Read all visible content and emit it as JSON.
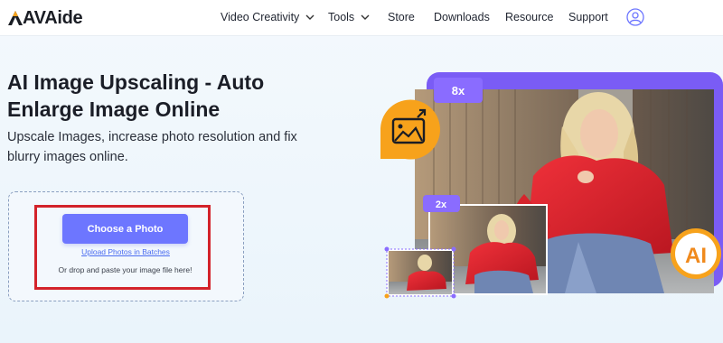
{
  "header": {
    "logo_text": "AVAide",
    "nav": [
      {
        "label": "Video Creativity",
        "has_dropdown": true
      },
      {
        "label": "Tools",
        "has_dropdown": true
      },
      {
        "label": "Store",
        "has_dropdown": false
      },
      {
        "label": "Downloads",
        "has_dropdown": false
      },
      {
        "label": "Resource",
        "has_dropdown": false
      },
      {
        "label": "Support",
        "has_dropdown": false
      }
    ],
    "user_icon": "user-circle-icon"
  },
  "hero": {
    "title": "AI Image Upscaling - Auto Enlarge Image Online",
    "subtitle": "Upscale Images, increase photo resolution and fix blurry images online."
  },
  "upload": {
    "choose_button": "Choose a Photo",
    "batch_link": "Upload Photos in Batches",
    "drop_text": "Or drop and paste your image file here!"
  },
  "illustration": {
    "badge_8x": "8x",
    "badge_2x": "2x",
    "ai_badge": "AI",
    "image_icon": "image-enlarge-icon"
  },
  "colors": {
    "accent": "#6d76ff",
    "highlight": "#d3222a",
    "orange": "#f7a21b",
    "purple": "#7a5cf5"
  }
}
